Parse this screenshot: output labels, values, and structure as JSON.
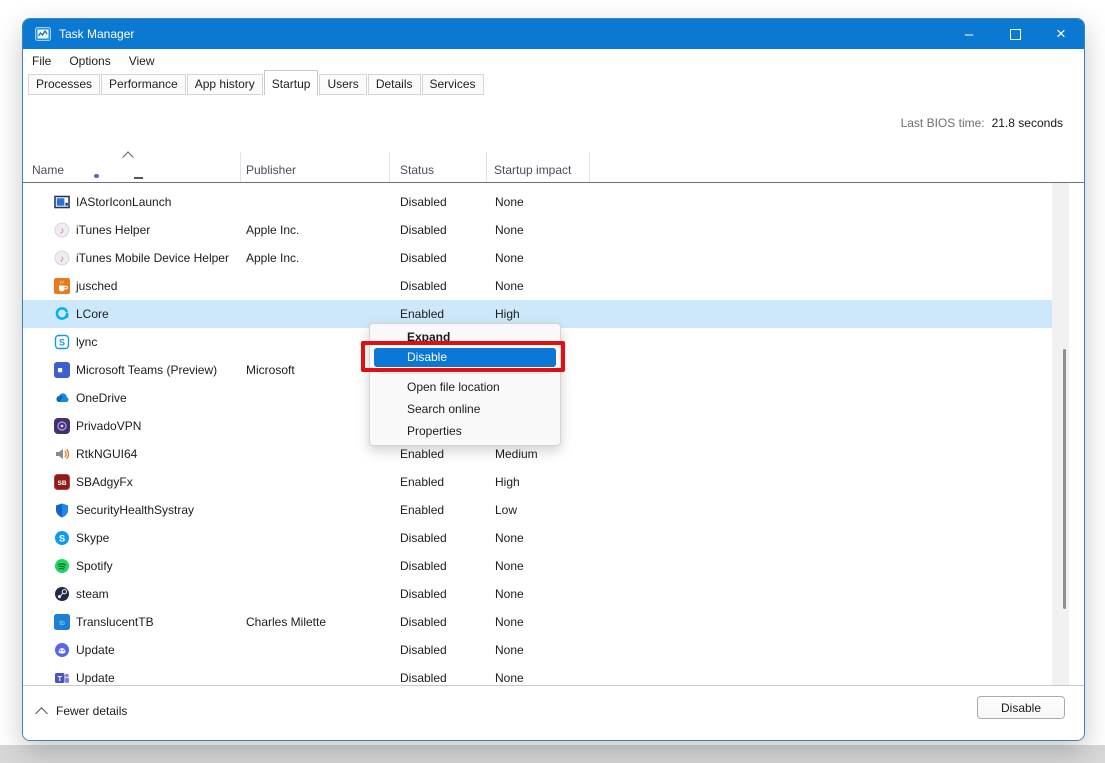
{
  "window": {
    "title": "Task Manager",
    "controls": {
      "minimize": "–",
      "close": "×"
    }
  },
  "menu_bar": {
    "items": [
      "File",
      "Options",
      "View"
    ]
  },
  "tabs": {
    "items": [
      {
        "label": "Processes",
        "active": false
      },
      {
        "label": "Performance",
        "active": false
      },
      {
        "label": "App history",
        "active": false
      },
      {
        "label": "Startup",
        "active": true
      },
      {
        "label": "Users",
        "active": false
      },
      {
        "label": "Details",
        "active": false
      },
      {
        "label": "Services",
        "active": false
      }
    ]
  },
  "info": {
    "last_bios_label": "Last BIOS time:",
    "last_bios_value": "21.8 seconds"
  },
  "table": {
    "columns": [
      "Name",
      "Publisher",
      "Status",
      "Startup impact"
    ],
    "sort": {
      "column": "Name",
      "direction": "ascending"
    },
    "rows": [
      {
        "icon": "iastor",
        "name": "IAStorIconLaunch",
        "publisher": "",
        "status": "Disabled",
        "impact": "None",
        "selected": false
      },
      {
        "icon": "itunes",
        "name": "iTunes Helper",
        "publisher": "Apple Inc.",
        "status": "Disabled",
        "impact": "None",
        "selected": false
      },
      {
        "icon": "itunes",
        "name": "iTunes Mobile Device Helper",
        "publisher": "Apple Inc.",
        "status": "Disabled",
        "impact": "None",
        "selected": false
      },
      {
        "icon": "java",
        "name": "jusched",
        "publisher": "",
        "status": "Disabled",
        "impact": "None",
        "selected": false
      },
      {
        "icon": "logitech",
        "name": "LCore",
        "publisher": "",
        "status": "Enabled",
        "impact": "High",
        "selected": true
      },
      {
        "icon": "lync",
        "name": "lync",
        "publisher": "",
        "status": "",
        "impact": "",
        "selected": false
      },
      {
        "icon": "teams",
        "name": "Microsoft Teams (Preview)",
        "publisher": "Microsoft",
        "status": "",
        "impact": "",
        "selected": false
      },
      {
        "icon": "onedrive",
        "name": "OneDrive",
        "publisher": "",
        "status": "",
        "impact": "",
        "selected": false
      },
      {
        "icon": "privado",
        "name": "PrivadoVPN",
        "publisher": "",
        "status": "",
        "impact": "",
        "selected": false
      },
      {
        "icon": "realtek",
        "name": "RtkNGUI64",
        "publisher": "",
        "status": "Enabled",
        "impact": "Medium",
        "selected": false
      },
      {
        "icon": "sb",
        "name": "SBAdgyFx",
        "publisher": "",
        "status": "Enabled",
        "impact": "High",
        "selected": false
      },
      {
        "icon": "shield",
        "name": "SecurityHealthSystray",
        "publisher": "",
        "status": "Enabled",
        "impact": "Low",
        "selected": false
      },
      {
        "icon": "skype",
        "name": "Skype",
        "publisher": "",
        "status": "Disabled",
        "impact": "None",
        "selected": false
      },
      {
        "icon": "spotify",
        "name": "Spotify",
        "publisher": "",
        "status": "Disabled",
        "impact": "None",
        "selected": false
      },
      {
        "icon": "steam",
        "name": "steam",
        "publisher": "",
        "status": "Disabled",
        "impact": "None",
        "selected": false
      },
      {
        "icon": "translucent",
        "name": "TranslucentTB",
        "publisher": "Charles Milette",
        "status": "Disabled",
        "impact": "None",
        "selected": false
      },
      {
        "icon": "discord",
        "name": "Update",
        "publisher": "",
        "status": "Disabled",
        "impact": "None",
        "selected": false
      },
      {
        "icon": "teams2",
        "name": "Update",
        "publisher": "",
        "status": "Disabled",
        "impact": "None",
        "selected": false
      }
    ]
  },
  "context_menu": {
    "items": [
      {
        "label": "Expand",
        "bold": true
      },
      {
        "label": "Disable",
        "highlighted": true,
        "annotated": true
      },
      {
        "label": "Open file location"
      },
      {
        "label": "Search online"
      },
      {
        "label": "Properties"
      }
    ]
  },
  "footer": {
    "details_toggle": "Fewer details",
    "disable_button": "Disable"
  },
  "colors": {
    "titlebar": "#0b79d1",
    "selection": "#cde8fa",
    "menu_highlight": "#0b77d6",
    "annotation": "#e01010"
  }
}
